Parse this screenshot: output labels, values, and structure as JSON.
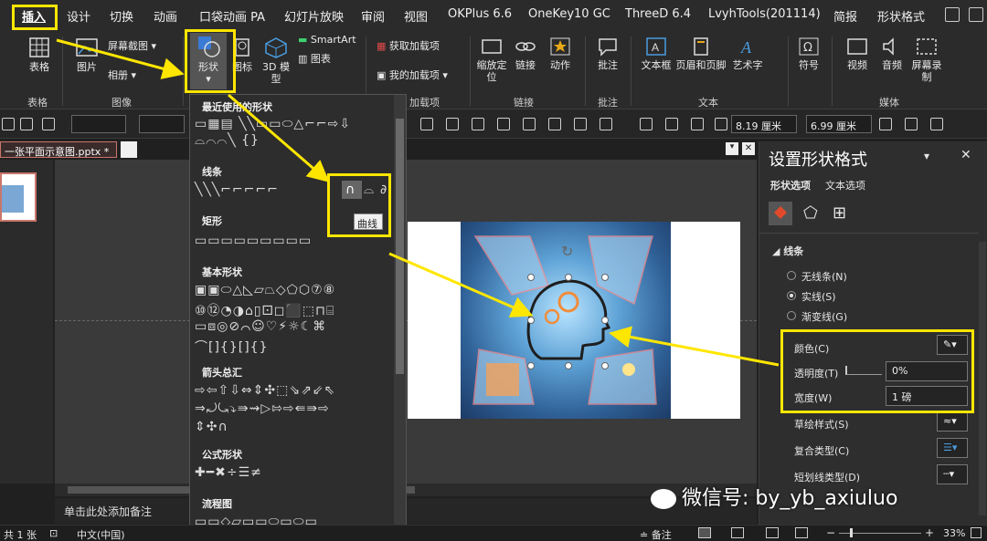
{
  "menu": {
    "items": [
      "插入",
      "设计",
      "切换",
      "动画",
      "口袋动画 PA",
      "幻灯片放映",
      "审阅",
      "视图",
      "OKPlus 6.6",
      "OneKey10 GC",
      "ThreeD 6.4",
      "LvyhTools(201114)",
      "简报",
      "形状格式"
    ]
  },
  "ribbon": {
    "table": "表格",
    "picture": "图片",
    "screenshot": "屏幕截图",
    "album": "相册",
    "shapes": "形状",
    "icons": "图标",
    "model3d": "3D 模型",
    "smartart": "SmartArt",
    "chart": "图表",
    "get_addins": "获取加载项",
    "my_addins": "我的加载项",
    "zoom": "缩放定位",
    "link": "链接",
    "action": "动作",
    "comment": "批注",
    "textbox": "文本框",
    "header_footer": "页眉和页脚",
    "wordart": "艺术字",
    "symbol": "符号",
    "video": "视频",
    "audio": "音频",
    "screen_record": "屏幕录制",
    "groups": {
      "table": "表格",
      "images": "图像",
      "addins": "加载项",
      "links": "链接",
      "comments": "批注",
      "text": "文本",
      "media": "媒体"
    }
  },
  "toolbar": {
    "width": "8.19 厘米",
    "height": "6.99 厘米"
  },
  "document": {
    "tab": "一张平面示意图.pptx *",
    "notes": "单击此处添加备注"
  },
  "dropdown": {
    "recent": "最近使用的形状",
    "lines": "线条",
    "rect": "矩形",
    "basic": "基本形状",
    "arrows": "箭头总汇",
    "equation": "公式形状",
    "flowchart": "流程图",
    "tooltip": "曲线"
  },
  "pane": {
    "title": "设置形状格式",
    "tab_shape": "形状选项",
    "tab_text": "文本选项",
    "section": "线条",
    "no_line": "无线条(N)",
    "solid": "实线(S)",
    "gradient": "渐变线(G)",
    "color": "颜色(C)",
    "transparency": "透明度(T)",
    "transparency_val": "0%",
    "width": "宽度(W)",
    "width_val": "1 磅",
    "sketch": "草绘样式(S)",
    "compound": "复合类型(C)",
    "dash": "短划线类型(D)"
  },
  "status": {
    "slide": "共 1 张",
    "lang": "中文(中国)",
    "notes": "备注",
    "zoom": "33%"
  },
  "watermark": "微信号: by_yb_axiuluo",
  "colors": {
    "highlight": "#ffe600",
    "accent": "#c43e1c"
  }
}
